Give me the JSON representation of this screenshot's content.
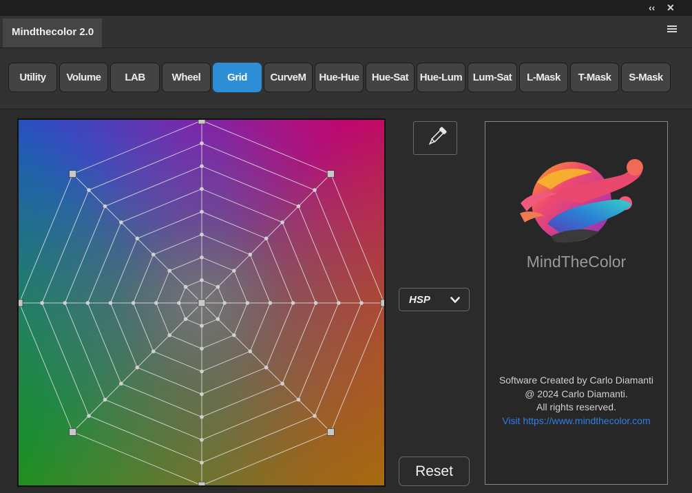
{
  "window": {
    "collapse_icon": "double-chevron-left-icon",
    "close_icon": "close-icon"
  },
  "panel": {
    "tab_title": "Mindthecolor 2.0",
    "menu_icon": "hamburger-menu-icon"
  },
  "modes": [
    {
      "label": "Utility",
      "active": false
    },
    {
      "label": "Volume",
      "active": false
    },
    {
      "label": "LAB",
      "active": false
    },
    {
      "label": "Wheel",
      "active": false
    },
    {
      "label": "Grid",
      "active": true
    },
    {
      "label": "CurveM",
      "active": false
    },
    {
      "label": "Hue-Hue",
      "active": false
    },
    {
      "label": "Hue-Sat",
      "active": false
    },
    {
      "label": "Hue-Lum",
      "active": false
    },
    {
      "label": "Lum-Sat",
      "active": false
    },
    {
      "label": "L-Mask",
      "active": false
    },
    {
      "label": "T-Mask",
      "active": false
    },
    {
      "label": "S-Mask",
      "active": false
    }
  ],
  "controls": {
    "eyedropper_icon": "eyedropper-icon",
    "color_model": "HSP",
    "reset_label": "Reset"
  },
  "about": {
    "brand": "MindTheColor",
    "line1": "Software Created by Carlo Diamanti",
    "line2": "@ 2024 Carlo Diamanti.",
    "line3": "All rights reserved.",
    "link": "Visit https://www.mindthecolor.com"
  },
  "colors": {
    "accent": "#2d8ed6",
    "link": "#2f7fe8"
  }
}
